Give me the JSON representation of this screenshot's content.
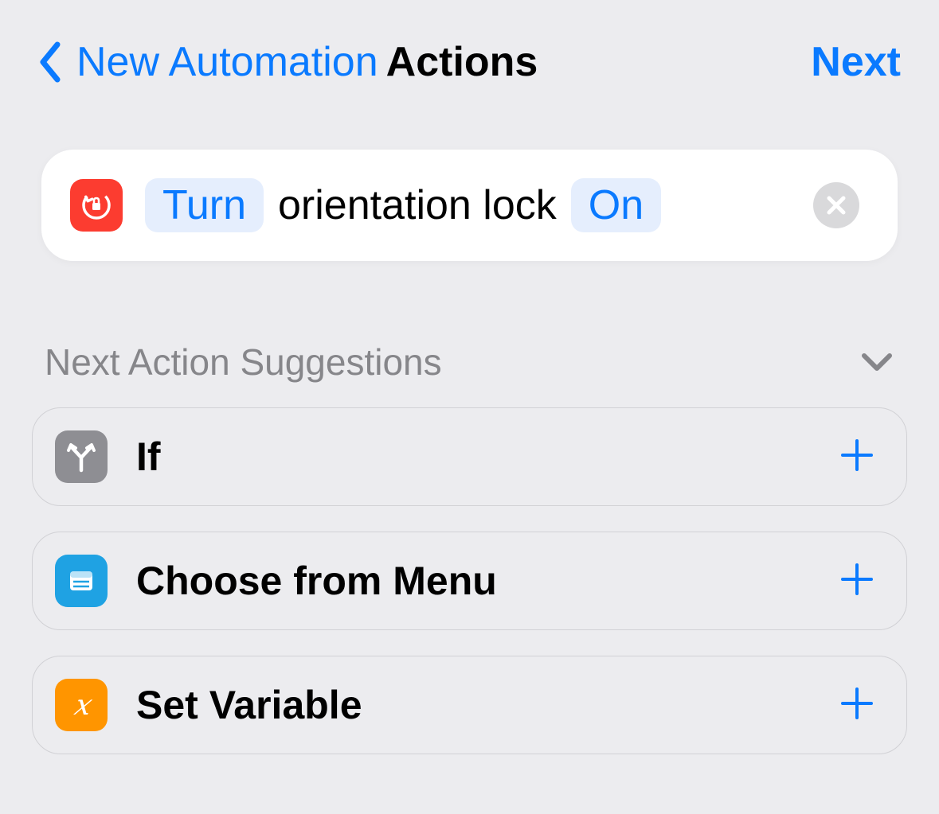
{
  "header": {
    "back_label": "New Automation",
    "title": "Actions",
    "next_label": "Next"
  },
  "action": {
    "turn_pill": "Turn",
    "subject": "orientation lock",
    "state_pill": "On"
  },
  "suggestions": {
    "title": "Next Action Suggestions",
    "items": [
      {
        "label": "If"
      },
      {
        "label": "Choose from Menu"
      },
      {
        "label": "Set Variable"
      }
    ]
  }
}
